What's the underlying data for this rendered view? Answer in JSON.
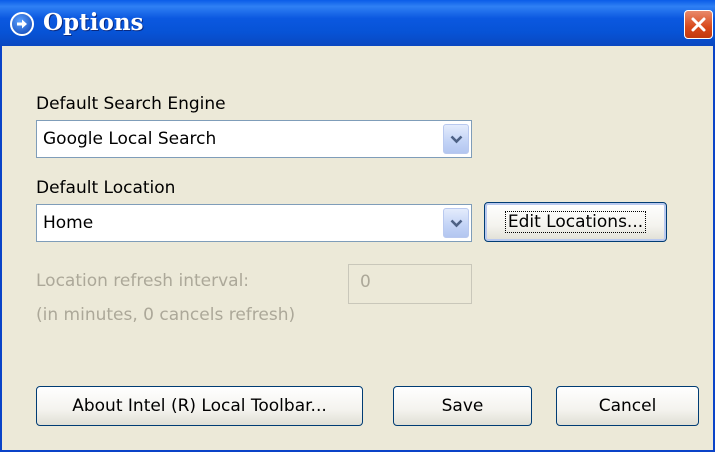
{
  "window": {
    "title": "Options",
    "icons": {
      "title_icon": "arrow-right-circle-icon",
      "close_icon": "close-x-icon"
    }
  },
  "search_engine": {
    "label": "Default Search Engine",
    "selected": "Google Local Search",
    "dropdown_icon": "chevron-down-icon"
  },
  "location": {
    "label": "Default Location",
    "selected": "Home",
    "edit_button": "Edit Locations..."
  },
  "refresh": {
    "label_line1": "Location refresh interval:",
    "label_line2": "(in minutes, 0 cancels refresh)",
    "value": "0",
    "disabled": true
  },
  "buttons": {
    "about": "About Intel (R) Local Toolbar...",
    "save": "Save",
    "cancel": "Cancel"
  },
  "colors": {
    "titlebar": "#0753d6",
    "dialog_bg": "#ece9d8",
    "close": "#d8481b",
    "disabled_text": "#aca899"
  }
}
